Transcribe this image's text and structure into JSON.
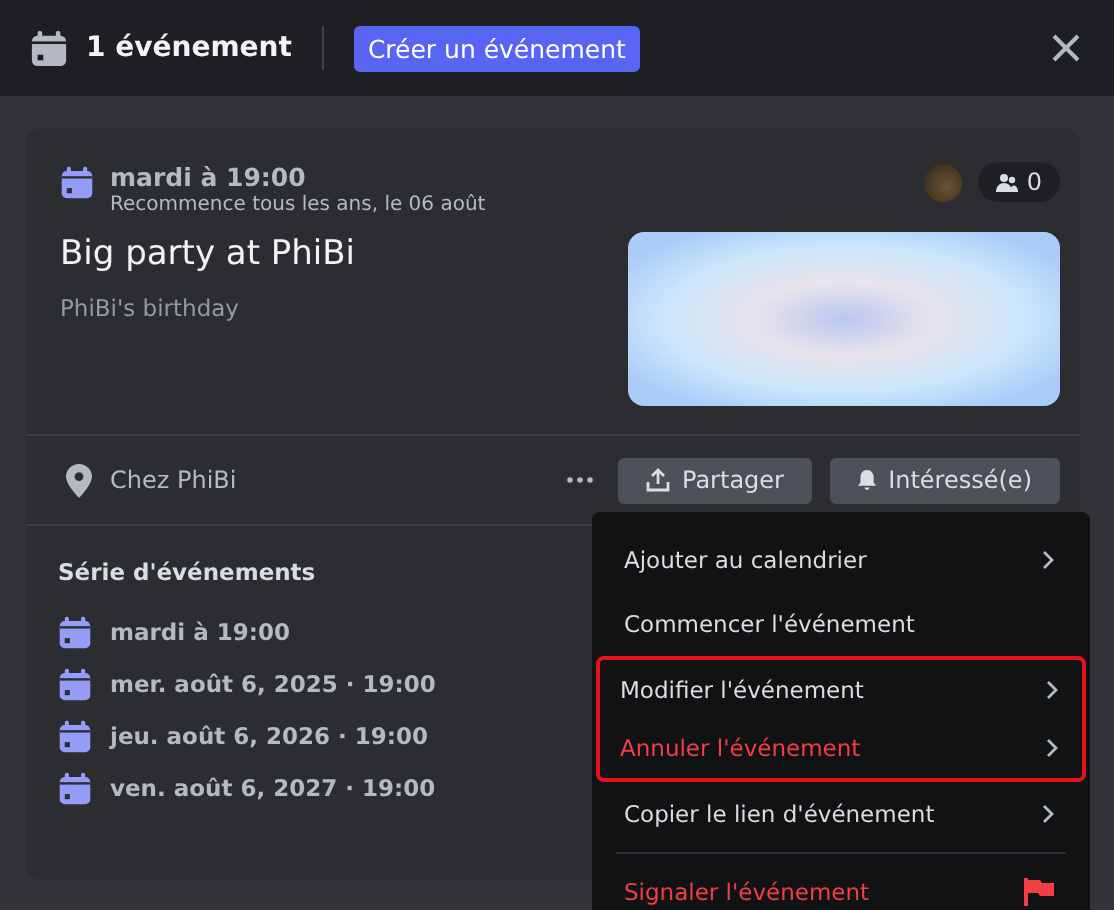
{
  "header": {
    "title": "1 événement",
    "create_button": "Créer un événement"
  },
  "event": {
    "when": "mardi à 19:00",
    "recurrence": "Recommence tous les ans, le 06 août",
    "interested_count": "0",
    "title": "Big party at PhiBi",
    "description": "PhiBi's birthday",
    "location": "Chez PhiBi",
    "buttons": [
      "Partager",
      "Intéressé(e)"
    ]
  },
  "series": {
    "heading": "Série d'événements",
    "dates": [
      "mardi à 19:00",
      "mer. août 6, 2025 · 19:00",
      "jeu. août 6, 2026 · 19:00",
      "ven. août 6, 2027 · 19:00"
    ]
  },
  "menu": {
    "items": [
      {
        "label": "Ajouter au calendrier",
        "danger": false,
        "submenu": true,
        "highlighted": false,
        "flag": false
      },
      {
        "label": "Commencer l'événement",
        "danger": false,
        "submenu": false,
        "highlighted": false,
        "flag": false
      },
      {
        "label": "Modifier l'événement",
        "danger": false,
        "submenu": true,
        "highlighted": true,
        "flag": false
      },
      {
        "label": "Annuler l'événement",
        "danger": true,
        "submenu": true,
        "highlighted": true,
        "flag": false
      },
      {
        "label": "Copier le lien d'événement",
        "danger": false,
        "submenu": true,
        "highlighted": false,
        "flag": false
      },
      {
        "label": "Signaler l'événement",
        "danger": true,
        "submenu": false,
        "highlighted": false,
        "flag": true
      }
    ]
  }
}
